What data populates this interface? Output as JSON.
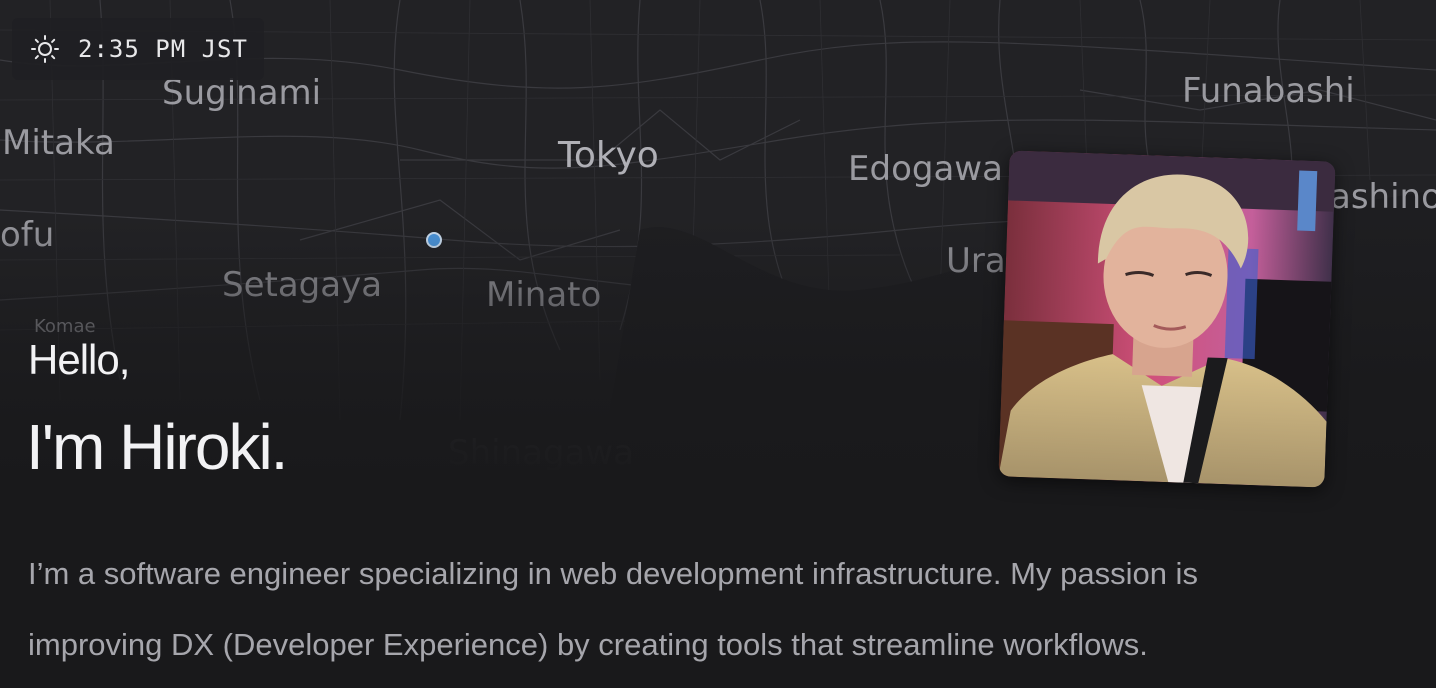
{
  "time_widget": {
    "icon": "sun-icon",
    "time": "2:35 PM JST"
  },
  "map": {
    "places": {
      "suginami": "Suginami",
      "mitaka": "Mitaka",
      "chofu": "ofu",
      "setagaya": "Setagaya",
      "komae": "Komae",
      "tokyo": "Tokyo",
      "minato": "Minato",
      "shinagawa": "Shinagawa",
      "edogawa": "Edogawa",
      "urayasu": "Ura",
      "funabashi": "Funabashi",
      "narashino": "ashino"
    },
    "location_marker_color": "#4c98e0"
  },
  "hero": {
    "greeting": "Hello,",
    "intro": "I'm Hiroki."
  },
  "profile_photo": {
    "icon": "profile-photo"
  },
  "bio": {
    "line1": "I’m a software engineer specializing in web development infrastructure. My passion is",
    "line2": "improving DX (Developer Experience) by creating tools that streamline workflows."
  }
}
